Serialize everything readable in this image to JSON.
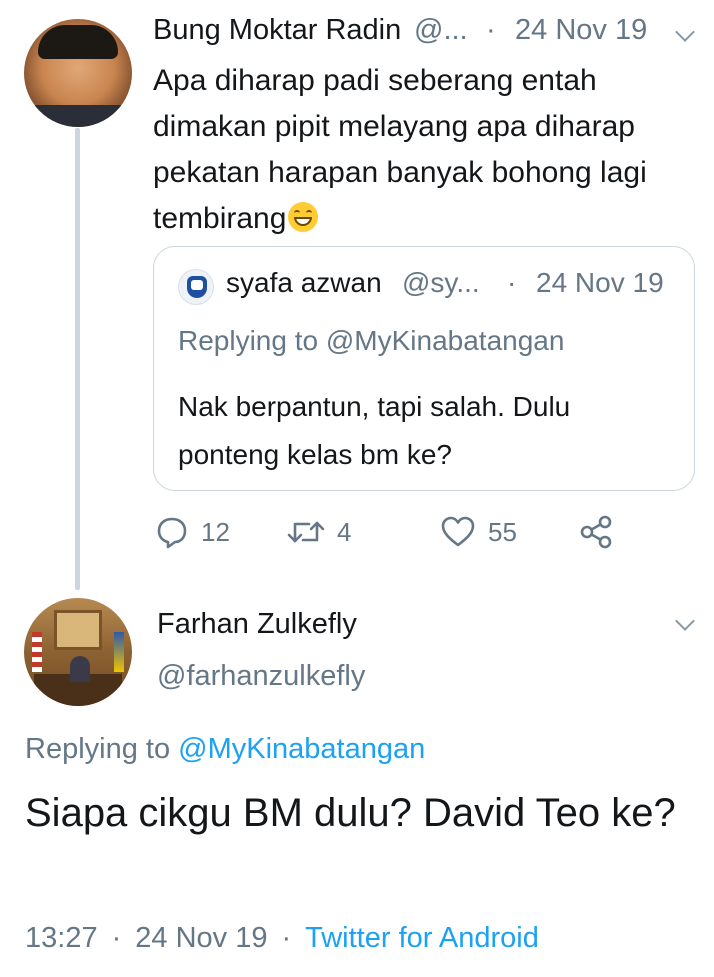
{
  "tweet1": {
    "name": "Bung Moktar Radin",
    "handle": "@...",
    "separator": "·",
    "date": "24 Nov 19",
    "text": "Apa diharap padi seberang entah dimakan pipit melayang apa diharap pekatan harapan banyak bohong lagi tembirang",
    "emoji_icon": "grinning-face-emoji",
    "quoted": {
      "name": "syafa azwan",
      "handle": "@sy...",
      "separator": "·",
      "date": "24 Nov 19",
      "replying_to": "Replying to @MyKinabatangan",
      "text": "Nak berpantun, tapi salah. Dulu ponteng kelas bm ke?"
    },
    "actions": {
      "reply_count": "12",
      "retweet_count": "4",
      "like_count": "55"
    }
  },
  "tweet2": {
    "name": "Farhan Zulkefly",
    "handle": "@farhanzulkefly",
    "replying_prefix": "Replying to ",
    "replying_mention": "@MyKinabatangan",
    "text": "Siapa cikgu BM dulu? David Teo ke?",
    "time": "13:27",
    "separator": "·",
    "date": "24 Nov 19",
    "source": "Twitter for Android"
  },
  "colors": {
    "text": "#14171a",
    "muted": "#657786",
    "link": "#1da1f2",
    "border": "#ccd6dd"
  }
}
